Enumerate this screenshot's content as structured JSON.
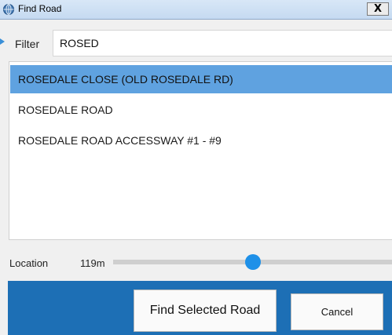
{
  "window": {
    "title": "Find Road",
    "close_label": "X"
  },
  "icons": {
    "app": "globe-app-icon",
    "close": "close-icon"
  },
  "filter": {
    "label": "Filter",
    "value": "ROSED"
  },
  "results": {
    "selected_index": 0,
    "items": [
      "ROSEDALE CLOSE (OLD ROSEDALE RD)",
      "ROSEDALE ROAD",
      "ROSEDALE ROAD ACCESSWAY #1 - #9"
    ]
  },
  "location": {
    "label": "Location",
    "value": "119m"
  },
  "buttons": {
    "find_selected": "Find Selected Road",
    "cancel": "Cancel"
  },
  "colors": {
    "selection": "#5fa2e0",
    "footer": "#1d6fb5",
    "slider_thumb": "#1e90e8"
  }
}
